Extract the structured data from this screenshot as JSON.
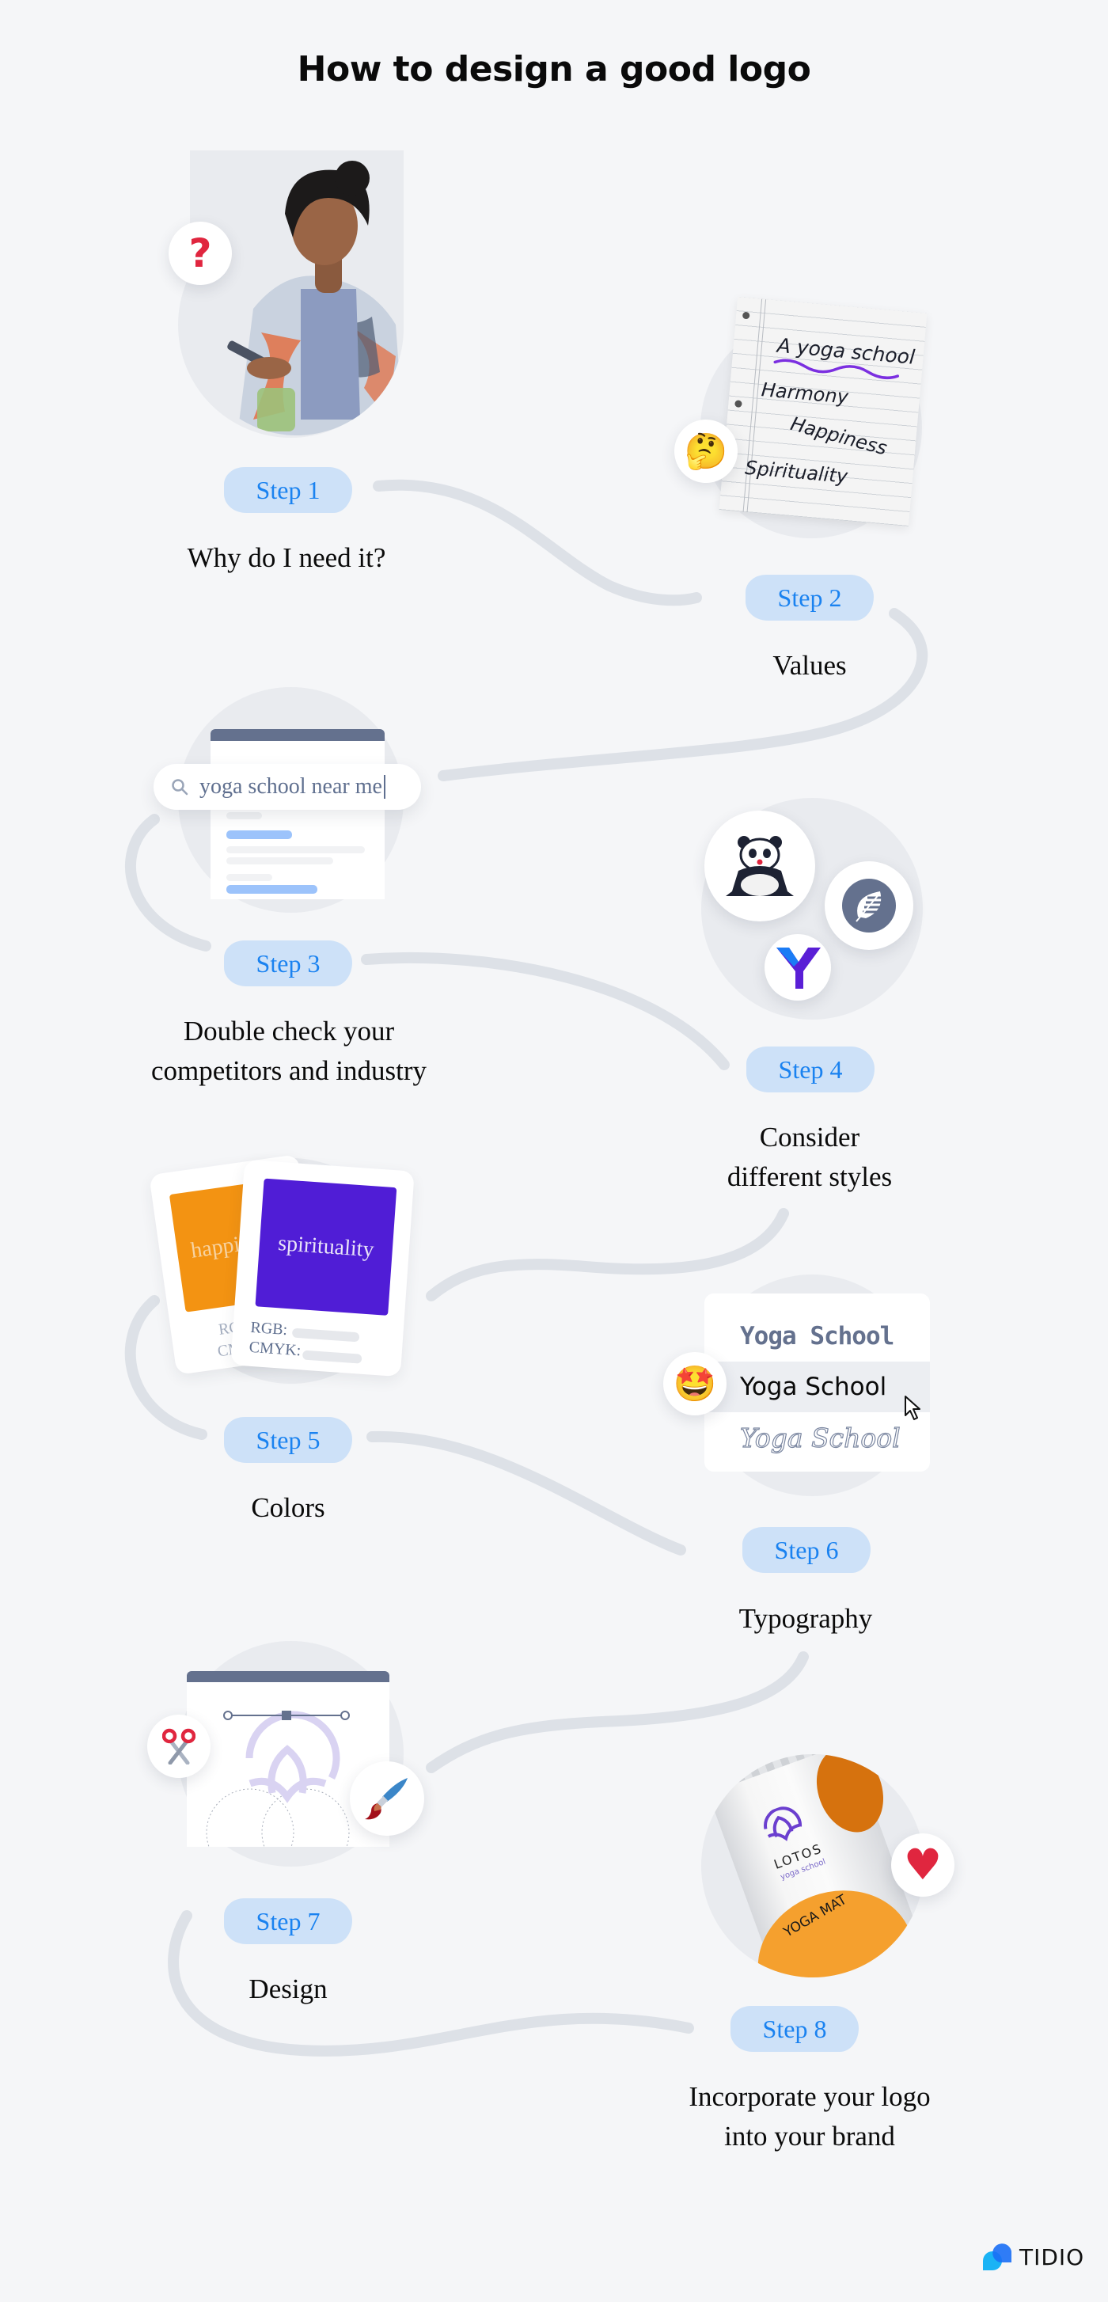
{
  "title": "How to design a good logo",
  "colors": {
    "background": "#f5f6f8",
    "step_badge_bg": "#cde1f8",
    "step_badge_text": "#1a82f0",
    "connector": "#dde1e7",
    "slate": "#64718e",
    "orange": "#f39312",
    "purple": "#501dd6",
    "red_accent": "#e0263f"
  },
  "steps": [
    {
      "label": "Step 1",
      "text": "Why do I need it?",
      "illustration": "woman-with-phone-photo",
      "badge_icon": "question-mark-icon",
      "badge_glyph": "?"
    },
    {
      "label": "Step 2",
      "text": "Values",
      "illustration": "notebook-paper",
      "badge_icon": "thinking-face-icon",
      "badge_glyph": "🤔",
      "notes": [
        "A yoga school",
        "Harmony",
        "Happiness",
        "Spirituality"
      ]
    },
    {
      "label": "Step 3",
      "text_lines": [
        "Double check your",
        "competitors and industry"
      ],
      "illustration": "search-results-browser",
      "search_query": "yoga school near me"
    },
    {
      "label": "Step 4",
      "text_lines": [
        "Consider",
        "different styles"
      ],
      "illustration": "logo-samples",
      "logos": [
        "panda-logo-icon",
        "leaf-logo-icon",
        "y-logo-icon"
      ]
    },
    {
      "label": "Step 5",
      "text": "Colors",
      "illustration": "color-swatch-cards",
      "cards": [
        {
          "word": "happiness",
          "visible_word": "hap",
          "color": "#f39312",
          "fields": [
            "RGB:",
            "CMYK:"
          ],
          "visible_fields": [
            "RG",
            "CM"
          ]
        },
        {
          "word": "spirituality",
          "color": "#501dd6",
          "fields": [
            "RGB:",
            "CMYK:"
          ]
        }
      ]
    },
    {
      "label": "Step 6",
      "text": "Typography",
      "illustration": "font-picker",
      "badge_icon": "star-struck-face-icon",
      "badge_glyph": "🤩",
      "font_samples": [
        "Yoga School",
        "Yoga School",
        "Yoga School"
      ],
      "selected_index": 1
    },
    {
      "label": "Step 7",
      "text": "Design",
      "illustration": "logo-design-board",
      "tools": [
        "scissors-icon",
        "paintbrush-icon"
      ]
    },
    {
      "label": "Step 8",
      "text_lines": [
        "Incorporate your logo",
        "into your brand"
      ],
      "illustration": "yoga-mat-product",
      "product": {
        "brand": "LOTOS",
        "tagline": "yoga school",
        "item": "YOGA MAT"
      },
      "badge_icon": "heart-icon",
      "badge_glyph": "♥"
    }
  ],
  "footer": {
    "brand": "TIDIO"
  }
}
